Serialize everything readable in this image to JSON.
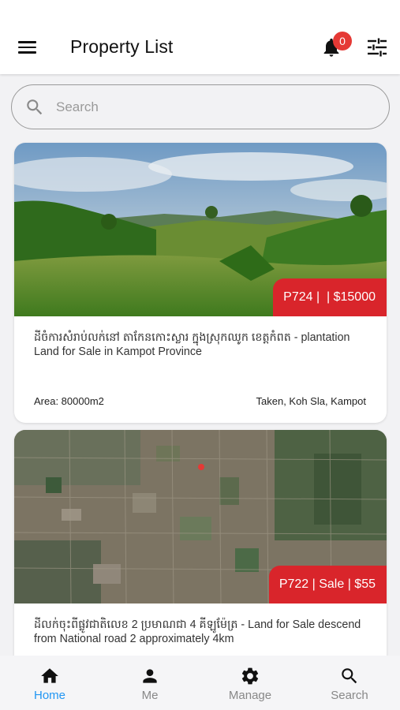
{
  "header": {
    "title": "Property List",
    "notification_count": "0",
    "menu_icon": "menu-icon",
    "bell_icon": "bell-icon",
    "filter_icon": "filter-icon"
  },
  "search": {
    "placeholder": "Search",
    "value": ""
  },
  "listings": [
    {
      "price_tag": "P724 |  | $15000",
      "title": "ដីចំការសំរាប់លក់នៅ តាកែនកោះស្លារ ក្នុងស្រុកឈូក ខេត្តកំពត - plantation Land for Sale in Kampot Province",
      "area": "Area: 80000m2",
      "location": "Taken, Koh Sla, Kampot",
      "image": "landscape-photo"
    },
    {
      "price_tag": "P722 | Sale | $55",
      "title": "ដីលក់ចុះពីផ្លូវជាតិលេខ 2 ប្រមាណជា 4 គីឡូម៉ែត្រ - Land for Sale descend from National road 2 approximately 4km",
      "image": "satellite-map-photo"
    }
  ],
  "bottom_nav": [
    {
      "label": "Home",
      "icon": "home-icon",
      "active": true
    },
    {
      "label": "Me",
      "icon": "person-icon",
      "active": false
    },
    {
      "label": "Manage",
      "icon": "gear-icon",
      "active": false
    },
    {
      "label": "Search",
      "icon": "search-icon",
      "active": false
    }
  ],
  "colors": {
    "accent": "#2196f3",
    "price_tag": "#d9252b",
    "badge": "#e53935"
  }
}
